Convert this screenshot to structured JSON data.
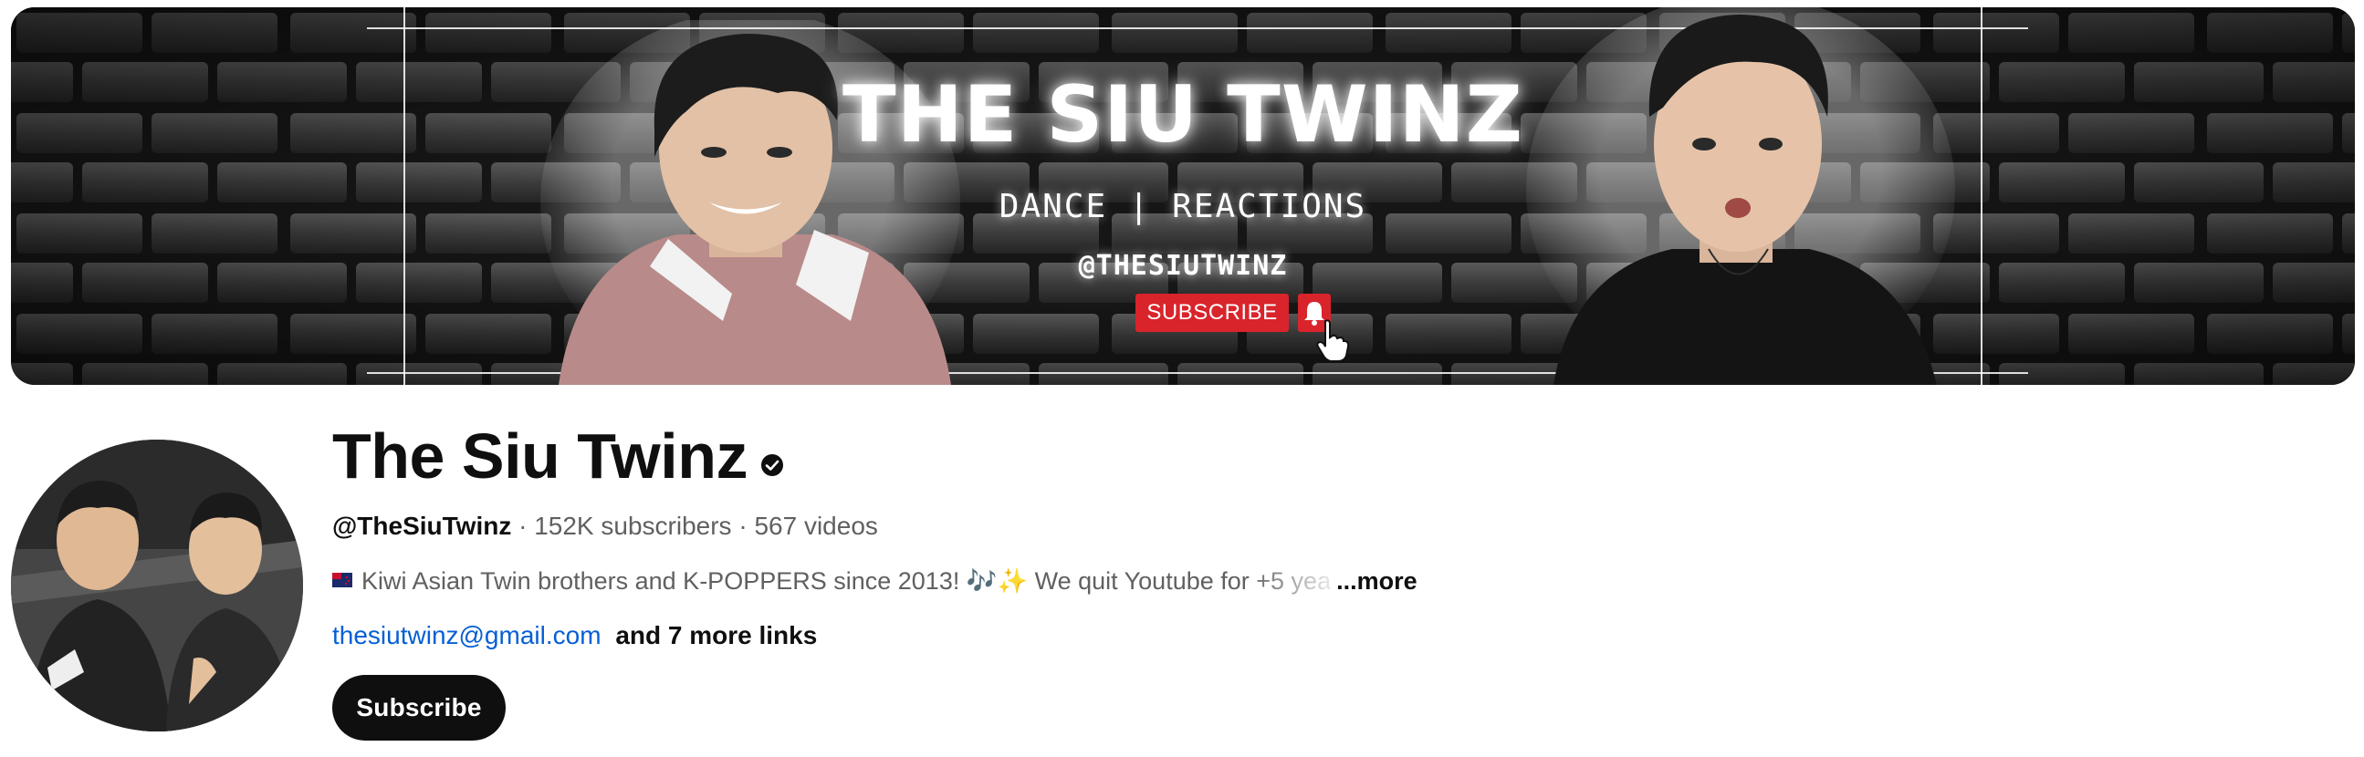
{
  "banner": {
    "title": "THE SIU TWINZ",
    "tagline": "DANCE | REACTIONS",
    "handle": "@THESIUTWINZ",
    "subscribe_label": "SUBSCRIBE",
    "bell_icon": "bell-icon",
    "cursor_icon": "hand-pointer-icon",
    "accent_color": "#d9242b"
  },
  "channel": {
    "name": "The Siu Twinz",
    "verified_icon": "verified-check-icon",
    "handle": "@TheSiuTwinz",
    "separator": "·",
    "subscribers": "152K subscribers",
    "videos": "567 videos",
    "description_main": "Kiwi Asian Twin brothers and K-POPPERS since 2013! 🎶✨ We quit Youtube for",
    "description_faded": " +5 yea",
    "description_more": "...more",
    "email_link": "thesiutwinz@gmail.com",
    "more_links": "and 7 more links",
    "subscribe_label": "Subscribe",
    "link_color": "#065fd4"
  }
}
